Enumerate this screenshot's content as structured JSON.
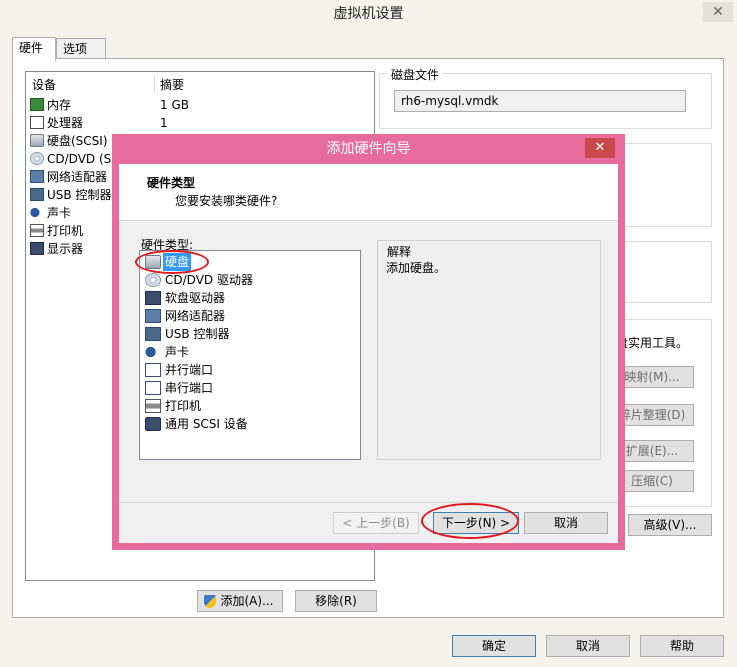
{
  "window": {
    "title": "虚拟机设置",
    "close_glyph": "✕"
  },
  "tabs": [
    {
      "label": "硬件"
    },
    {
      "label": "选项"
    }
  ],
  "device_list": {
    "headers": {
      "device": "设备",
      "summary": "摘要"
    },
    "rows": [
      {
        "name": "内存",
        "summary": "1 GB",
        "icon": "memory-icon"
      },
      {
        "name": "处理器",
        "summary": "1",
        "icon": "processor-icon"
      },
      {
        "name": "硬盘(SCSI)",
        "summary": "",
        "icon": "hard-disk-icon"
      },
      {
        "name": "CD/DVD (SA",
        "summary": "",
        "icon": "cd-dvd-icon"
      },
      {
        "name": "网络适配器",
        "summary": "",
        "icon": "network-adapter-icon"
      },
      {
        "name": "USB 控制器",
        "summary": "",
        "icon": "usb-icon"
      },
      {
        "name": "声卡",
        "summary": "",
        "icon": "sound-card-icon"
      },
      {
        "name": "打印机",
        "summary": "",
        "icon": "printer-icon"
      },
      {
        "name": "显示器",
        "summary": "",
        "icon": "display-icon"
      }
    ]
  },
  "disk_file": {
    "label": "磁盘文件",
    "value": "rh6-mysql.vmdk"
  },
  "utilities": {
    "text": "盘实用工具。",
    "buttons": [
      "映射(M)...",
      "碎片整理(D)",
      "扩展(E)...",
      "压缩(C)"
    ],
    "advanced": "高级(V)..."
  },
  "bottom_buttons": {
    "add": "添加(A)...",
    "remove": "移除(R)"
  },
  "footer_buttons": {
    "ok": "确定",
    "cancel": "取消",
    "help": "帮助"
  },
  "dialog": {
    "title": "添加硬件向导",
    "close_glyph": "✕",
    "header_title": "硬件类型",
    "header_subtitle": "您要安装哪类硬件?",
    "list_label": "硬件类型:",
    "items": [
      {
        "name": "硬盘",
        "icon": "hard-disk-icon",
        "selected": true
      },
      {
        "name": "CD/DVD 驱动器",
        "icon": "cd-dvd-icon"
      },
      {
        "name": "软盘驱动器",
        "icon": "floppy-icon"
      },
      {
        "name": "网络适配器",
        "icon": "network-adapter-icon"
      },
      {
        "name": "USB 控制器",
        "icon": "usb-icon"
      },
      {
        "name": "声卡",
        "icon": "sound-card-icon"
      },
      {
        "name": "并行端口",
        "icon": "parallel-port-icon"
      },
      {
        "name": "串行端口",
        "icon": "serial-port-icon"
      },
      {
        "name": "打印机",
        "icon": "printer-icon"
      },
      {
        "name": "通用 SCSI 设备",
        "icon": "scsi-device-icon"
      }
    ],
    "explain_label": "解释",
    "explain_text": "添加硬盘。",
    "buttons": {
      "back": "< 上一步(B)",
      "next": "下一步(N) >",
      "cancel": "取消"
    }
  },
  "colors": {
    "dialog_frame": "#e76b9c",
    "selection": "#3399ff",
    "annotation": "#e0171b"
  }
}
